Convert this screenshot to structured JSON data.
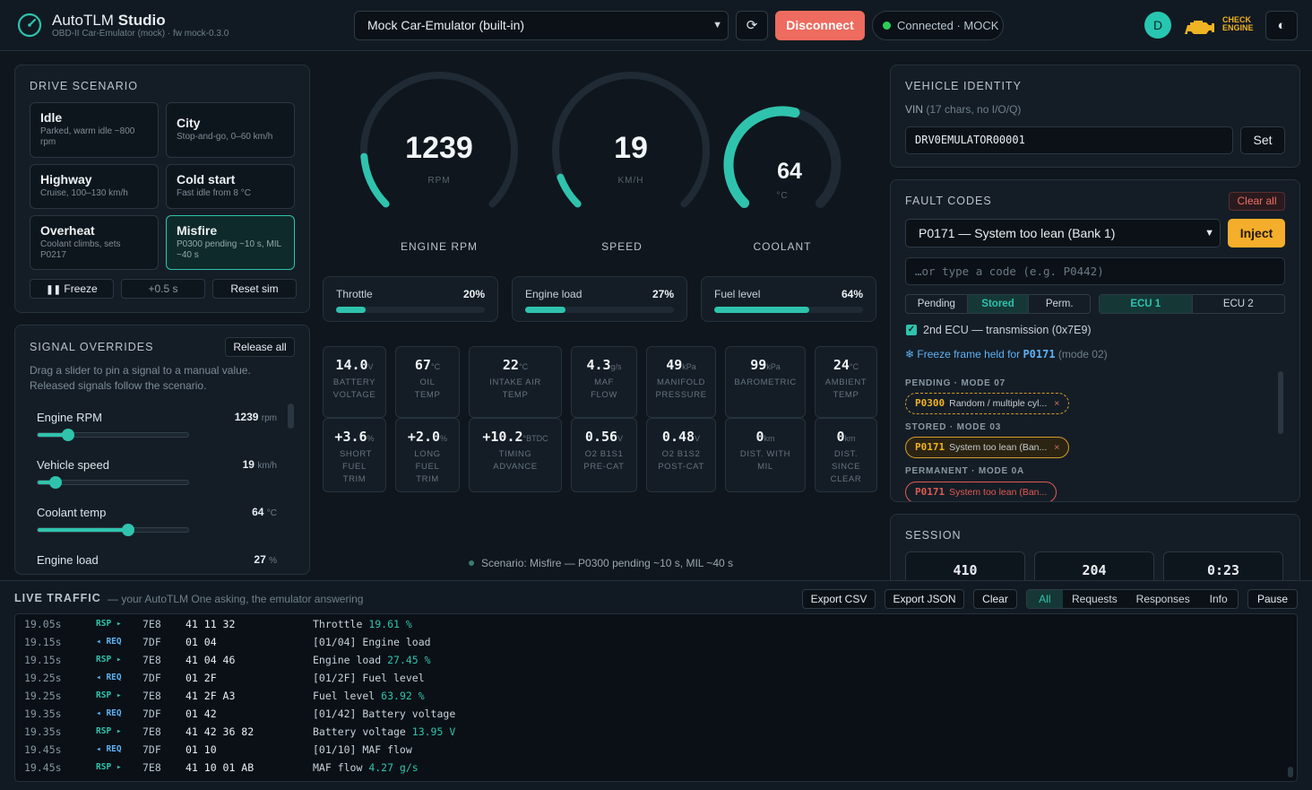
{
  "header": {
    "app_name": "AutoTLM",
    "app_name_bold": "Studio",
    "subtitle": "OBD-II Car-Emulator (mock) · fw mock-0.3.0",
    "device": "Mock Car-Emulator (built-in)",
    "disconnect": "Disconnect",
    "status": "Connected · MOCK",
    "avatar": "D",
    "check_engine_1": "CHECK",
    "check_engine_2": "ENGINE"
  },
  "drive": {
    "title": "DRIVE SCENARIO",
    "scenarios": [
      {
        "name": "Idle",
        "desc": "Parked, warm idle ~800 rpm"
      },
      {
        "name": "City",
        "desc": "Stop-and-go, 0–60 km/h"
      },
      {
        "name": "Highway",
        "desc": "Cruise, 100–130 km/h"
      },
      {
        "name": "Cold start",
        "desc": "Fast idle from 8 °C"
      },
      {
        "name": "Overheat",
        "desc": "Coolant climbs, sets P0217"
      },
      {
        "name": "Misfire",
        "desc": "P0300 pending ~10 s, MIL ~40 s"
      }
    ],
    "freeze": "Freeze",
    "step": "+0.5 s",
    "reset": "Reset sim"
  },
  "overrides": {
    "title": "SIGNAL OVERRIDES",
    "release": "Release all",
    "desc": "Drag a slider to pin a signal to a manual value. Released signals follow the scenario.",
    "items": [
      {
        "label": "Engine RPM",
        "value": "1239",
        "unit": "rpm",
        "level": 0.2
      },
      {
        "label": "Vehicle speed",
        "value": "19",
        "unit": "km/h",
        "level": 0.12
      },
      {
        "label": "Coolant temp",
        "value": "64",
        "unit": "°C",
        "level": 0.6
      },
      {
        "label": "Engine load",
        "value": "27",
        "unit": "%",
        "level": 0.27
      }
    ]
  },
  "gauges": [
    {
      "value": "1239",
      "unit": "RPM",
      "label": "ENGINE RPM",
      "level": 0.15
    },
    {
      "value": "19",
      "unit": "KM/H",
      "label": "SPEED",
      "level": 0.09
    },
    {
      "value": "64",
      "unit": "°C",
      "label": "COOLANT",
      "level": 0.55
    }
  ],
  "bars": [
    {
      "label": "Throttle",
      "value": "20%",
      "level": 0.2
    },
    {
      "label": "Engine load",
      "value": "27%",
      "level": 0.27
    },
    {
      "label": "Fuel level",
      "value": "64%",
      "level": 0.64
    }
  ],
  "tiles": [
    {
      "value": "14.0",
      "unit": "V",
      "caption": "BATTERY VOLTAGE"
    },
    {
      "value": "67",
      "unit": "°C",
      "caption": "OIL TEMP"
    },
    {
      "value": "22",
      "unit": "°C",
      "caption": "INTAKE AIR TEMP"
    },
    {
      "value": "4.3",
      "unit": "g/s",
      "caption": "MAF FLOW"
    },
    {
      "value": "49",
      "unit": "kPa",
      "caption": "MANIFOLD PRESSURE"
    },
    {
      "value": "99",
      "unit": "kPa",
      "caption": "BAROMETRIC"
    },
    {
      "value": "24",
      "unit": "°C",
      "caption": "AMBIENT TEMP"
    },
    {
      "value": "+3.6",
      "unit": "%",
      "caption": "SHORT FUEL TRIM"
    },
    {
      "value": "+2.0",
      "unit": "%",
      "caption": "LONG FUEL TRIM"
    },
    {
      "value": "+10.2",
      "unit": "°BTDC",
      "caption": "TIMING ADVANCE"
    },
    {
      "value": "0.56",
      "unit": "V",
      "caption": "O2 B1S1 PRE-CAT"
    },
    {
      "value": "0.48",
      "unit": "V",
      "caption": "O2 B1S2 POST-CAT"
    },
    {
      "value": "0",
      "unit": "km",
      "caption": "DIST. WITH MIL"
    },
    {
      "value": "0",
      "unit": "km",
      "caption": "DIST. SINCE CLEAR"
    }
  ],
  "scenario_status": "Scenario: Misfire — P0300 pending ~10 s, MIL ~40 s",
  "vehicle": {
    "title": "VEHICLE IDENTITY",
    "vin_label": "VIN",
    "vin_hint": "(17 chars, no I/O/Q)",
    "vin": "DRV0EMULATOR00001",
    "set": "Set"
  },
  "faults": {
    "title": "FAULT CODES",
    "clear_all": "Clear all",
    "selected": "P0171 — System too lean (Bank 1)",
    "inject": "Inject",
    "placeholder": "…or type a code (e.g. P0442)",
    "types": [
      "Pending",
      "Stored",
      "Perm."
    ],
    "ecus": [
      "ECU 1",
      "ECU 2"
    ],
    "second_ecu": "2nd ECU — transmission (0x7E9)",
    "freeze_text": "❄ Freeze frame held for",
    "freeze_code": "P0171",
    "freeze_mode": "(mode 02)",
    "pending_h": "PENDING · MODE 07",
    "pending": {
      "code": "P0300",
      "desc": "Random / multiple cyl..."
    },
    "stored_h": "STORED · MODE 03",
    "stored": {
      "code": "P0171",
      "desc": "System too lean (Ban..."
    },
    "perm_h": "PERMANENT · MODE 0A",
    "perm": {
      "code": "P0171",
      "desc": "System too lean (Ban..."
    }
  },
  "session": {
    "title": "SESSION",
    "values": [
      "410",
      "204",
      "0:23"
    ]
  },
  "traffic": {
    "title": "LIVE TRAFFIC",
    "subtitle": "— your AutoTLM One asking, the emulator answering",
    "export_csv": "Export CSV",
    "export_json": "Export JSON",
    "clear": "Clear",
    "filters": [
      "All",
      "Requests",
      "Responses",
      "Info"
    ],
    "pause": "Pause",
    "rows": [
      {
        "t": "19.05s",
        "kind": "RSP ▸",
        "id": "7E8",
        "bytes": "41 11 32",
        "desc": "Throttle ",
        "val": "19.61 %"
      },
      {
        "t": "19.15s",
        "kind": "◂ REQ",
        "id": "7DF",
        "bytes": "01 04",
        "desc": "[01/04] Engine load",
        "val": ""
      },
      {
        "t": "19.15s",
        "kind": "RSP ▸",
        "id": "7E8",
        "bytes": "41 04 46",
        "desc": "Engine load ",
        "val": "27.45 %"
      },
      {
        "t": "19.25s",
        "kind": "◂ REQ",
        "id": "7DF",
        "bytes": "01 2F",
        "desc": "[01/2F] Fuel level",
        "val": ""
      },
      {
        "t": "19.25s",
        "kind": "RSP ▸",
        "id": "7E8",
        "bytes": "41 2F A3",
        "desc": "Fuel level ",
        "val": "63.92 %"
      },
      {
        "t": "19.35s",
        "kind": "◂ REQ",
        "id": "7DF",
        "bytes": "01 42",
        "desc": "[01/42] Battery voltage",
        "val": ""
      },
      {
        "t": "19.35s",
        "kind": "RSP ▸",
        "id": "7E8",
        "bytes": "41 42 36 82",
        "desc": "Battery voltage ",
        "val": "13.95 V"
      },
      {
        "t": "19.45s",
        "kind": "◂ REQ",
        "id": "7DF",
        "bytes": "01 10",
        "desc": "[01/10] MAF flow",
        "val": ""
      },
      {
        "t": "19.45s",
        "kind": "RSP ▸",
        "id": "7E8",
        "bytes": "41 10 01 AB",
        "desc": "MAF flow ",
        "val": "4.27 g/s"
      }
    ]
  },
  "colors": {
    "accent": "#2fc3ad",
    "danger": "#ee6b5f",
    "warning": "#f4ae2b",
    "bg": "#0f161d"
  }
}
